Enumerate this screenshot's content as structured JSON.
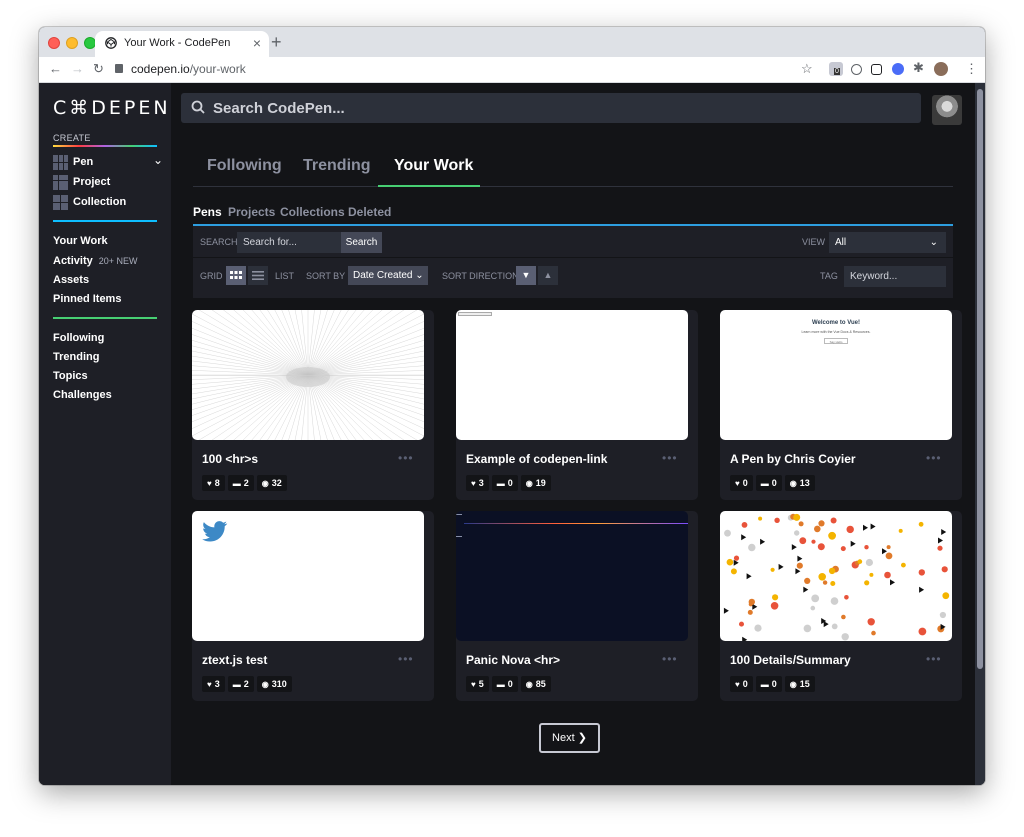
{
  "browser": {
    "tab_title": "Your Work - CodePen",
    "url_host": "codepen.io",
    "url_path": "/your-work",
    "extension_badge": "0"
  },
  "sidebar": {
    "logo": "C⌘DEPEN",
    "create_label": "CREATE",
    "create_items": [
      {
        "label": "Pen"
      },
      {
        "label": "Project"
      },
      {
        "label": "Collection"
      }
    ],
    "nav_main": [
      {
        "label": "Your Work"
      },
      {
        "label": "Activity",
        "badge": "20+ NEW"
      },
      {
        "label": "Assets"
      },
      {
        "label": "Pinned Items"
      }
    ],
    "nav_secondary": [
      {
        "label": "Following"
      },
      {
        "label": "Trending"
      },
      {
        "label": "Topics"
      },
      {
        "label": "Challenges"
      }
    ]
  },
  "search": {
    "placeholder": "Search CodePen..."
  },
  "main_tabs": [
    {
      "label": "Following"
    },
    {
      "label": "Trending"
    },
    {
      "label": "Your Work",
      "active": true
    }
  ],
  "sub_tabs": [
    {
      "label": "Pens",
      "active": true
    },
    {
      "label": "Projects"
    },
    {
      "label": "Collections"
    },
    {
      "label": "Deleted"
    }
  ],
  "controls": {
    "search_label": "SEARCH",
    "search_placeholder": "Search for...",
    "search_button": "Search",
    "view_label": "VIEW",
    "view_value": "All",
    "grid_label": "GRID",
    "list_label": "LIST",
    "sortby_label": "SORT BY",
    "sortby_value": "Date Created",
    "sortdir_label": "SORT DIRECTION",
    "tag_label": "TAG",
    "tag_placeholder": "Keyword..."
  },
  "pens": [
    {
      "title": "100 <hr>s",
      "likes": "8",
      "comments": "2",
      "views": "32"
    },
    {
      "title": "Example of codepen-link",
      "likes": "3",
      "comments": "0",
      "views": "19"
    },
    {
      "title": "A Pen by Chris Coyier",
      "likes": "0",
      "comments": "0",
      "views": "13"
    },
    {
      "title": "ztext.js test",
      "likes": "3",
      "comments": "2",
      "views": "310"
    },
    {
      "title": "Panic Nova <hr>",
      "likes": "5",
      "comments": "0",
      "views": "85"
    },
    {
      "title": "100 Details/Summary",
      "likes": "0",
      "comments": "0",
      "views": "15"
    }
  ],
  "thumb_text": {
    "vue_title": "Welcome to Vue!",
    "vue_sub": "Learn more with the Vue Docs & Resources.",
    "vue_btn": "Say Hello"
  },
  "pagination": {
    "next": "Next"
  },
  "colors": {
    "accent_green": "#47cf73",
    "accent_blue": "#0ebeff",
    "bg_dark": "#131417",
    "panel": "#1e1f26"
  }
}
